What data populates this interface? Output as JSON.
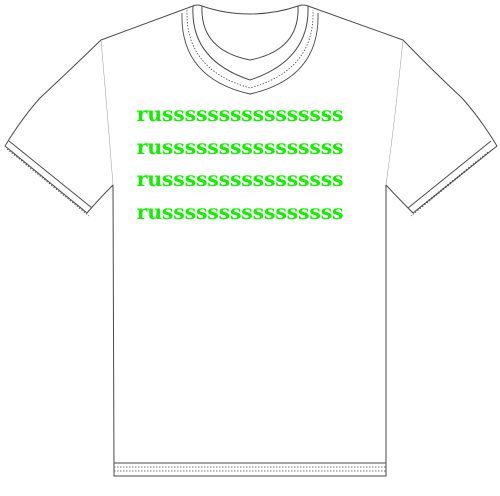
{
  "shirt": {
    "color": "#ffffff",
    "outline_color": "#4a4a4a",
    "print_color": "#12f000",
    "print_lines": [
      "russssssssssssssss",
      "russssssssssssssss",
      "russssssssssssssss",
      "russssssssssssssss"
    ]
  }
}
